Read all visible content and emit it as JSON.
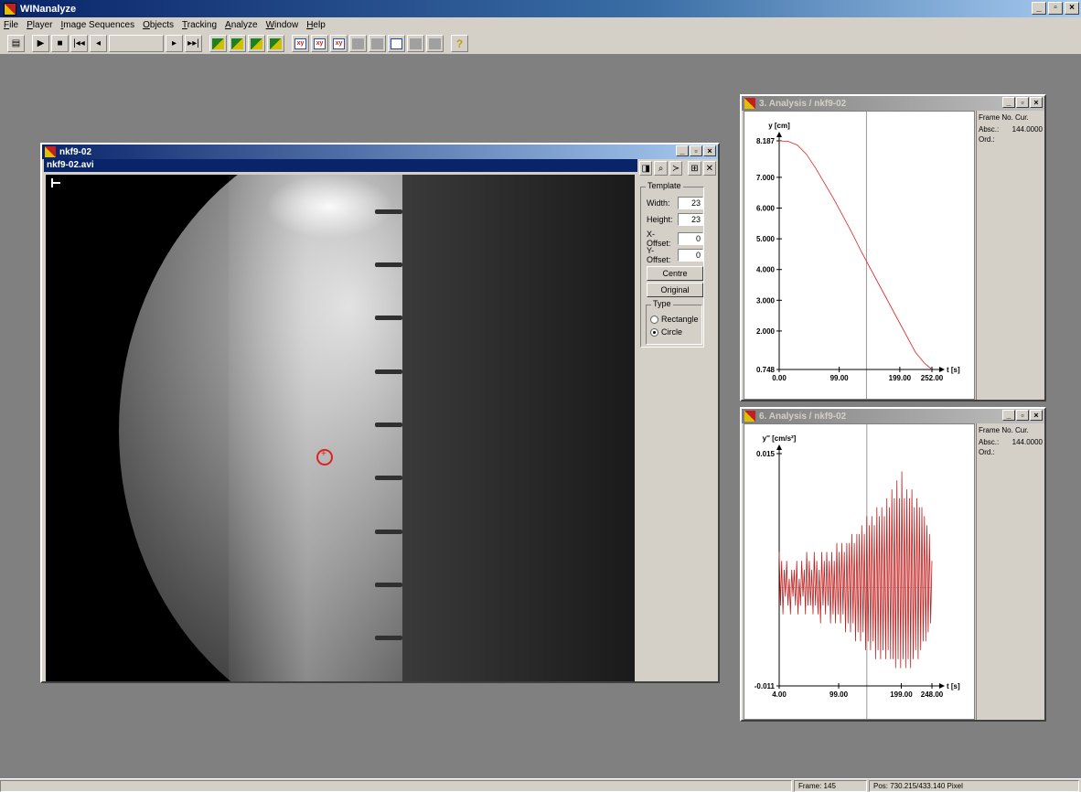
{
  "app": {
    "title": "WINanalyze"
  },
  "menu": [
    "File",
    "Player",
    "Image Sequences",
    "Objects",
    "Tracking",
    "Analyze",
    "Window",
    "Help"
  ],
  "title_buttons": {
    "minimize": "_",
    "restore": "▫",
    "close": "×"
  },
  "video_window": {
    "title": "nkf9-02",
    "subtitle": "nkf9-02.avi",
    "template": {
      "group_label": "Template",
      "width_label": "Width:",
      "width_value": "23",
      "height_label": "Height:",
      "height_value": "23",
      "xoffset_label": "X-Offset:",
      "xoffset_value": "0",
      "yoffset_label": "Y-Offset:",
      "yoffset_value": "0",
      "centre_button": "Centre",
      "original_button": "Original",
      "type_label": "Type",
      "rectangle_label": "Rectangle",
      "circle_label": "Circle"
    }
  },
  "analysis1": {
    "title": "3. Analysis / nkf9-02",
    "info_header": "Frame No. Cur.",
    "absc_label": "Absc.:",
    "absc_value": "144.0000",
    "ord_label": "Ord.:"
  },
  "analysis2": {
    "title": "6. Analysis / nkf9-02",
    "info_header": "Frame No. Cur.",
    "absc_label": "Absc.:",
    "absc_value": "144.0000",
    "ord_label": "Ord.:"
  },
  "chart_data": [
    {
      "type": "line",
      "ylabel": "y [cm]",
      "xlabel": "t [s]",
      "xlim": [
        0,
        252
      ],
      "ylim": [
        0.748,
        8.187
      ],
      "xticks": [
        "0.00",
        "99.00",
        "199.00",
        "252.00"
      ],
      "yticks": [
        "8.187",
        "7.000",
        "6.000",
        "5.000",
        "4.000",
        "3.000",
        "2.000",
        "0.748"
      ],
      "cursor_x": 144,
      "color": "#e02020",
      "x": [
        0,
        15,
        30,
        45,
        60,
        75,
        90,
        105,
        120,
        135,
        150,
        165,
        180,
        195,
        210,
        225,
        240,
        252
      ],
      "y": [
        8.187,
        8.17,
        8.05,
        7.75,
        7.3,
        6.8,
        6.3,
        5.75,
        5.2,
        4.6,
        4.05,
        3.5,
        2.95,
        2.4,
        1.85,
        1.3,
        0.95,
        0.748
      ]
    },
    {
      "type": "line",
      "ylabel": "y'' [cm/s²]",
      "xlabel": "t [s]",
      "xlim": [
        4,
        248
      ],
      "ylim": [
        -0.011,
        0.015
      ],
      "xticks": [
        "4.00",
        "99.00",
        "199.00",
        "248.00"
      ],
      "yticks": [
        "0.015",
        "-0.011"
      ],
      "cursor_x": 144,
      "color": "#c02020",
      "x": [
        4,
        6,
        8,
        10,
        12,
        14,
        16,
        18,
        20,
        22,
        24,
        26,
        28,
        30,
        32,
        34,
        36,
        38,
        40,
        42,
        44,
        46,
        48,
        50,
        52,
        54,
        56,
        58,
        60,
        62,
        64,
        66,
        68,
        70,
        72,
        74,
        76,
        78,
        80,
        82,
        84,
        86,
        88,
        90,
        92,
        94,
        96,
        98,
        100,
        102,
        104,
        106,
        108,
        110,
        112,
        114,
        116,
        118,
        120,
        122,
        124,
        126,
        128,
        130,
        132,
        134,
        136,
        138,
        140,
        142,
        144,
        146,
        148,
        150,
        152,
        154,
        156,
        158,
        160,
        162,
        164,
        166,
        168,
        170,
        172,
        174,
        176,
        178,
        180,
        182,
        184,
        186,
        188,
        190,
        192,
        194,
        196,
        198,
        200,
        202,
        204,
        206,
        208,
        210,
        212,
        214,
        216,
        218,
        220,
        222,
        224,
        226,
        228,
        230,
        232,
        234,
        236,
        238,
        240,
        242,
        244,
        246,
        248
      ],
      "y": [
        0.004,
        -0.002,
        0.003,
        -0.003,
        0.002,
        -0.001,
        0.003,
        -0.002,
        0.001,
        -0.003,
        0.002,
        -0.001,
        0.002,
        -0.002,
        0.003,
        -0.003,
        0.001,
        -0.002,
        0.003,
        -0.001,
        0.002,
        -0.003,
        0.004,
        -0.002,
        0.003,
        -0.002,
        0.002,
        -0.003,
        0.004,
        -0.002,
        0.003,
        -0.003,
        0.002,
        -0.004,
        0.004,
        -0.002,
        0.003,
        -0.003,
        0.004,
        -0.002,
        0.003,
        -0.004,
        0.004,
        -0.003,
        0.003,
        -0.004,
        0.005,
        -0.003,
        0.004,
        -0.004,
        0.005,
        -0.003,
        0.004,
        -0.005,
        0.005,
        -0.004,
        0.005,
        -0.005,
        0.006,
        -0.004,
        0.005,
        -0.006,
        0.006,
        -0.005,
        0.006,
        -0.006,
        0.007,
        -0.005,
        0.006,
        -0.007,
        0.008,
        -0.006,
        0.007,
        -0.007,
        0.008,
        -0.006,
        0.007,
        -0.008,
        0.009,
        -0.007,
        0.008,
        -0.008,
        0.009,
        -0.007,
        0.008,
        -0.008,
        0.01,
        -0.007,
        0.009,
        -0.008,
        0.011,
        -0.008,
        0.01,
        -0.009,
        0.012,
        -0.008,
        0.01,
        -0.009,
        0.013,
        -0.008,
        0.01,
        -0.009,
        0.011,
        -0.008,
        0.01,
        -0.009,
        0.011,
        -0.008,
        0.009,
        -0.007,
        0.01,
        -0.008,
        0.009,
        -0.007,
        0.009,
        -0.006,
        0.008,
        -0.006,
        0.007,
        -0.005,
        0.006,
        -0.004,
        0.003
      ]
    }
  ],
  "status": {
    "frame": "Frame: 145",
    "pos": "Pos: 730.215/433.140 Pixel"
  }
}
